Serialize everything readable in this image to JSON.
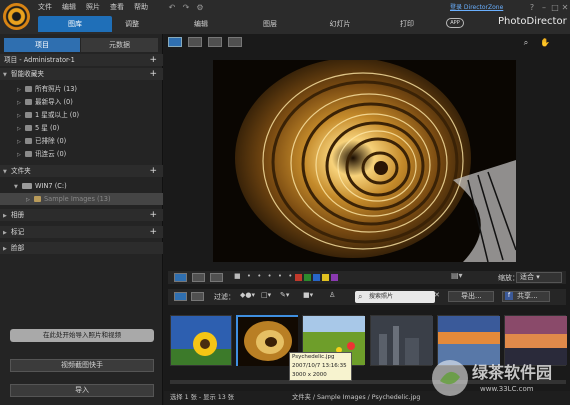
{
  "menu": {
    "items": [
      "文件",
      "编辑",
      "照片",
      "查看",
      "帮助"
    ],
    "login_link": "登录 DirectorZone"
  },
  "modes": [
    "图库",
    "调整",
    "编辑",
    "图层",
    "幻灯片",
    "打印"
  ],
  "app_badge": "APP",
  "brand": "PhotoDirector",
  "panel": {
    "tabs": [
      "项目",
      "元数据"
    ],
    "project_title": "项目 - Administrator-1",
    "smart_section": "智能收藏夹",
    "smart_items": [
      "所有照片 (13)",
      "最新导入 (0)",
      "1 星或以上 (0)",
      "5 星 (0)",
      "已排除 (0)",
      "讯连云 (0)"
    ],
    "folders_section": "文件夹",
    "drive": "WIN7 (C:)",
    "sample_folder": "Sample Images (13)",
    "albums": "相册",
    "tags": "标记",
    "faces": "脸部",
    "import_hint": "在此处开始导入照片和视频",
    "snapshot": "视频截图快手",
    "import": "导入"
  },
  "toolbar": {
    "filter": "过滤：",
    "search_placeholder": "搜索照片",
    "export": "导出...",
    "share": "共享...",
    "zoom_label": "缩放：",
    "zoom_value": "适合"
  },
  "tooltip": {
    "name": "Psychedelic.jpg",
    "date": "2007/10/7 13:16:35",
    "size": "3000 x 2000"
  },
  "status": {
    "left": "选择 1 张 - 显示 13 张",
    "path": "文件夹 / Sample Images / Psychedelic.jpg"
  },
  "watermark": {
    "title": "绿茶软件园",
    "url": "www.33LC.com"
  },
  "colors": {
    "accent": "#1f6fb8",
    "labels": [
      "#c0392b",
      "#2d8a2d",
      "#2866c8",
      "#e0c020",
      "#8a3ab0"
    ]
  }
}
